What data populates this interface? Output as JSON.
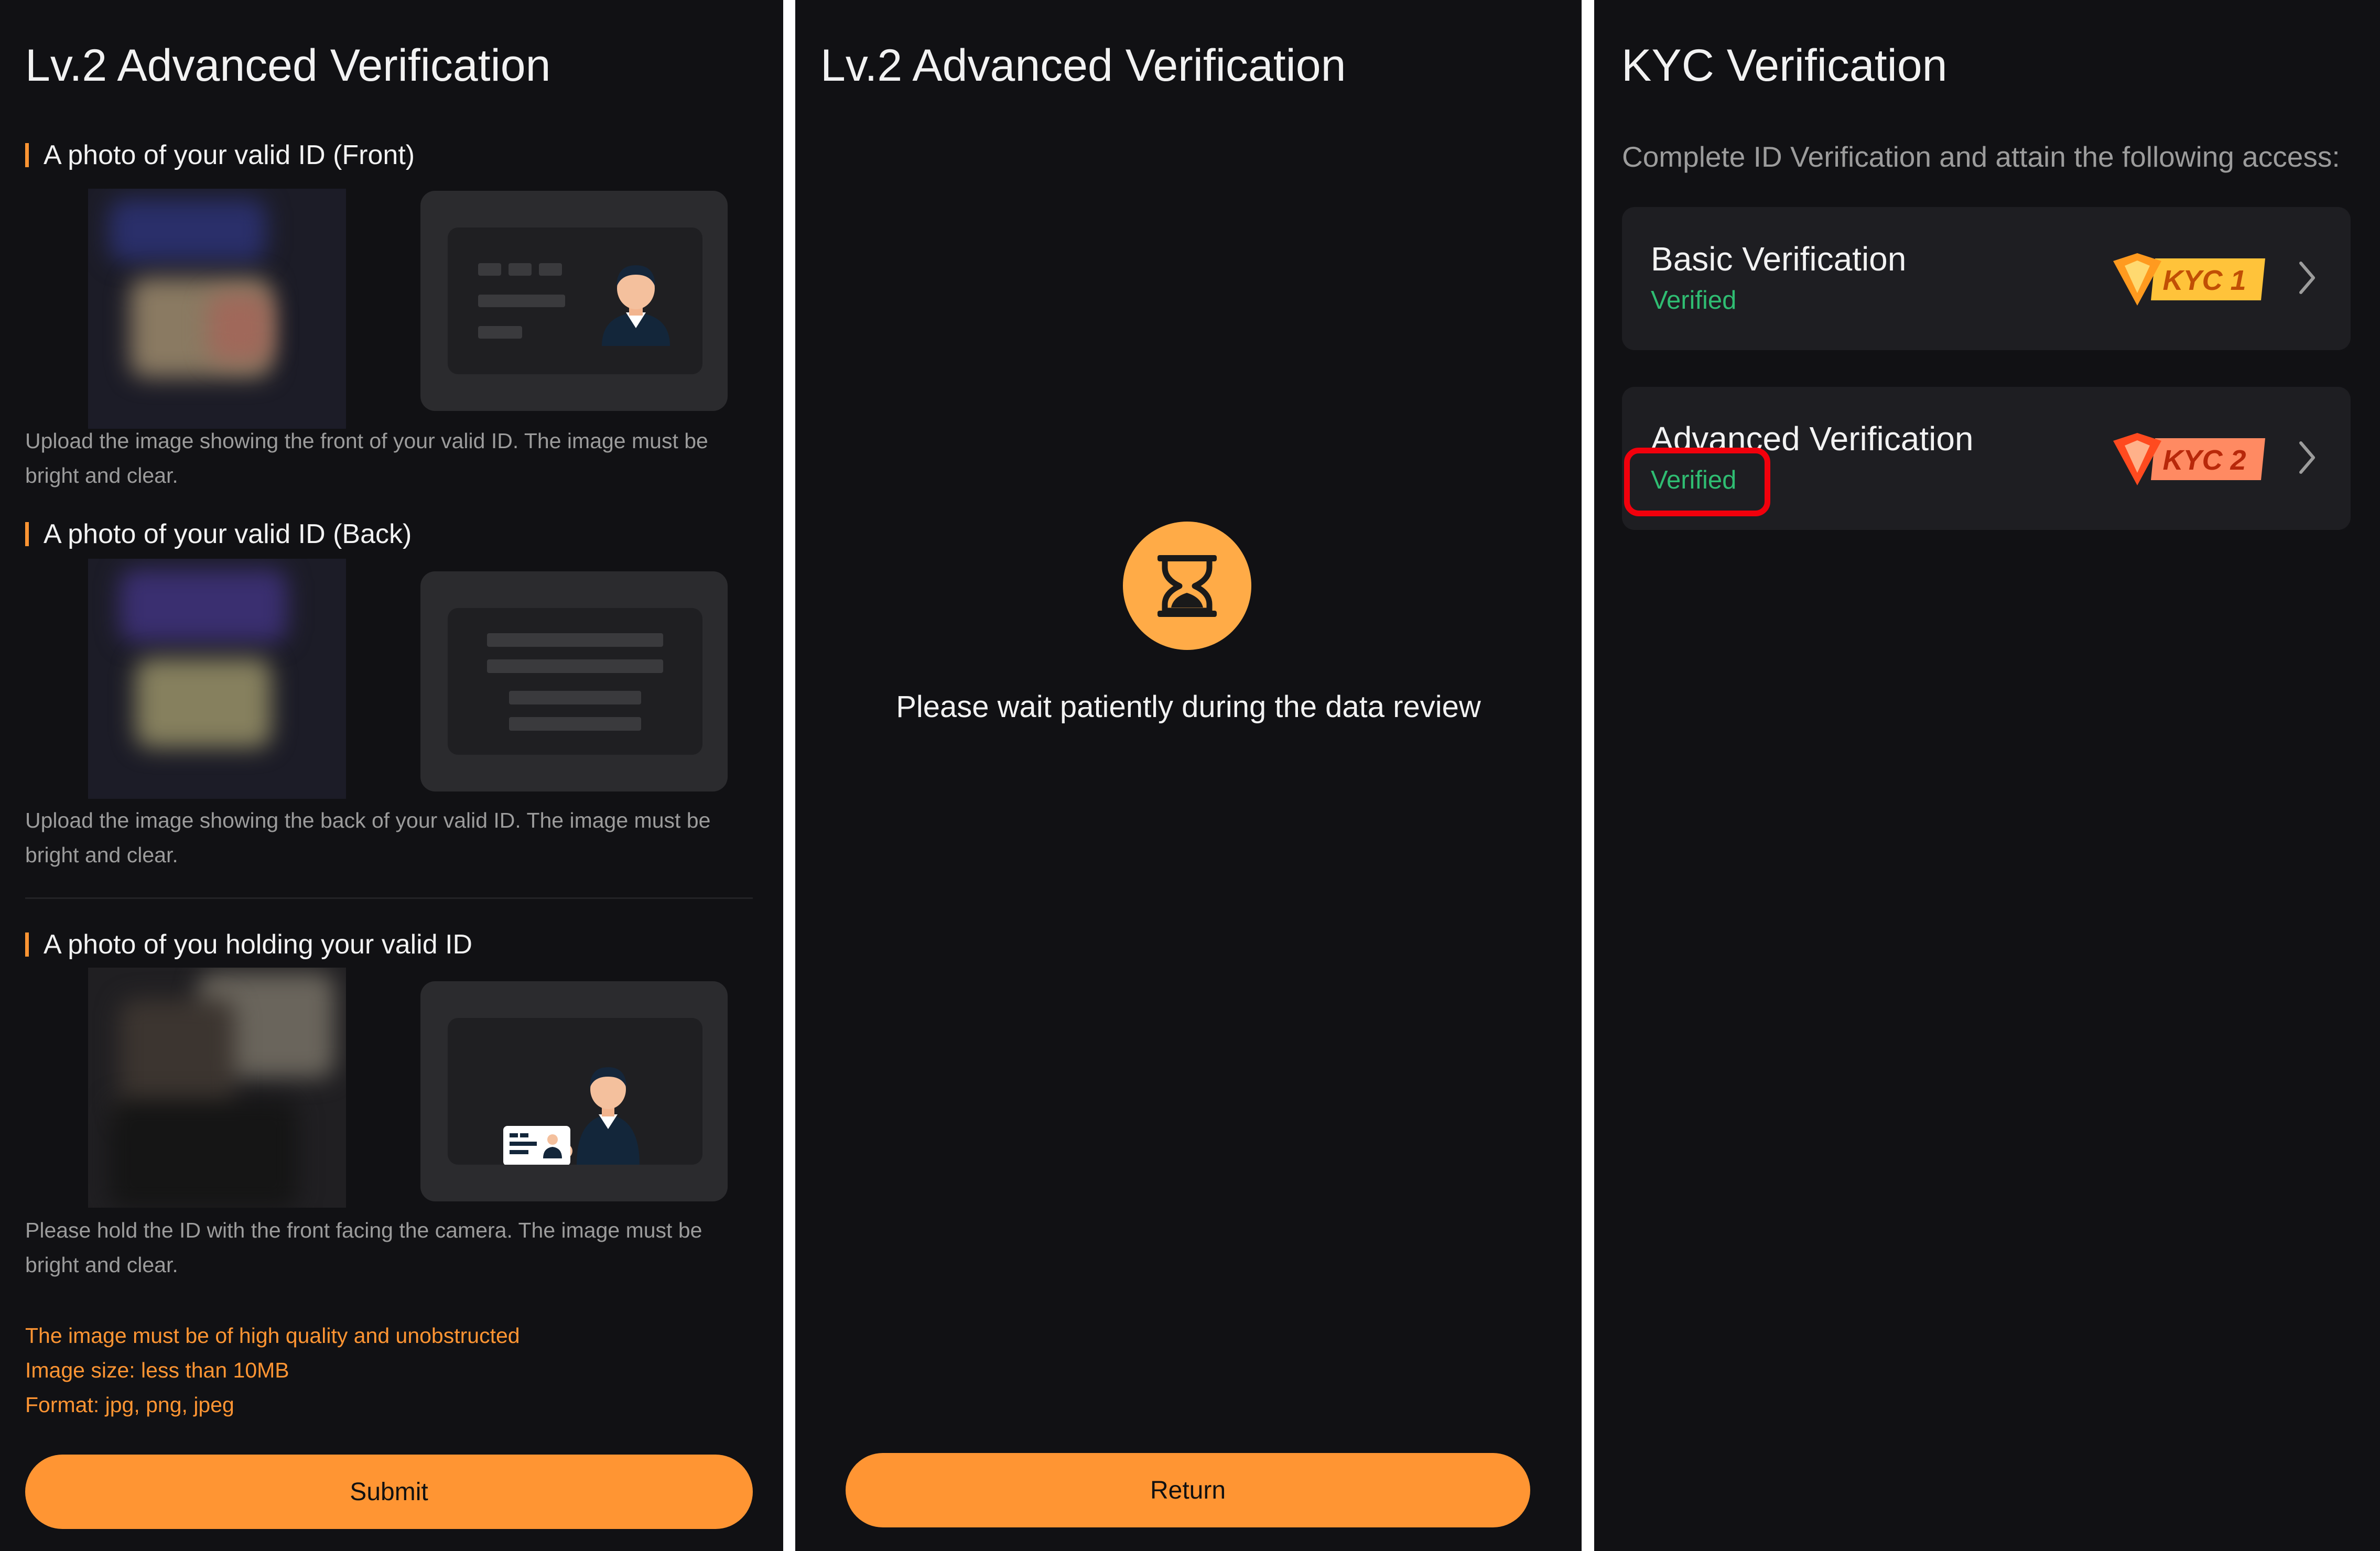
{
  "panel_upload": {
    "title": "Lv.2 Advanced Verification",
    "front": {
      "label": "A photo of your valid ID (Front)",
      "hint": "Upload the image showing the front of your valid ID. The image must be bright and clear."
    },
    "back": {
      "label": "A photo of your valid ID (Back)",
      "hint": "Upload the image showing the back of your valid ID. The image must be bright and clear."
    },
    "holding": {
      "label": "A photo of you holding your valid ID",
      "hint": "Please hold the ID with the front facing the camera. The image must be bright and clear."
    },
    "requirements": [
      "The image must be of high quality and unobstructed",
      "Image size: less than 10MB",
      "Format: jpg, png, jpeg"
    ],
    "submit_label": "Submit"
  },
  "panel_review": {
    "title": "Lv.2 Advanced Verification",
    "icon": "hourglass-icon",
    "message": "Please wait patiently during the data review",
    "return_label": "Return"
  },
  "panel_kyc": {
    "title": "KYC Verification",
    "subtitle": "Complete ID Verification and attain the following access:",
    "items": [
      {
        "title": "Basic Verification",
        "status": "Verified",
        "badge": "KYC 1"
      },
      {
        "title": "Advanced Verification",
        "status": "Verified",
        "badge": "KYC 2"
      }
    ]
  },
  "colors": {
    "accent": "#ff9533",
    "background": "#111114",
    "card": "#1e1e22",
    "verified": "#2fbd72",
    "highlight": "#f2000c"
  }
}
